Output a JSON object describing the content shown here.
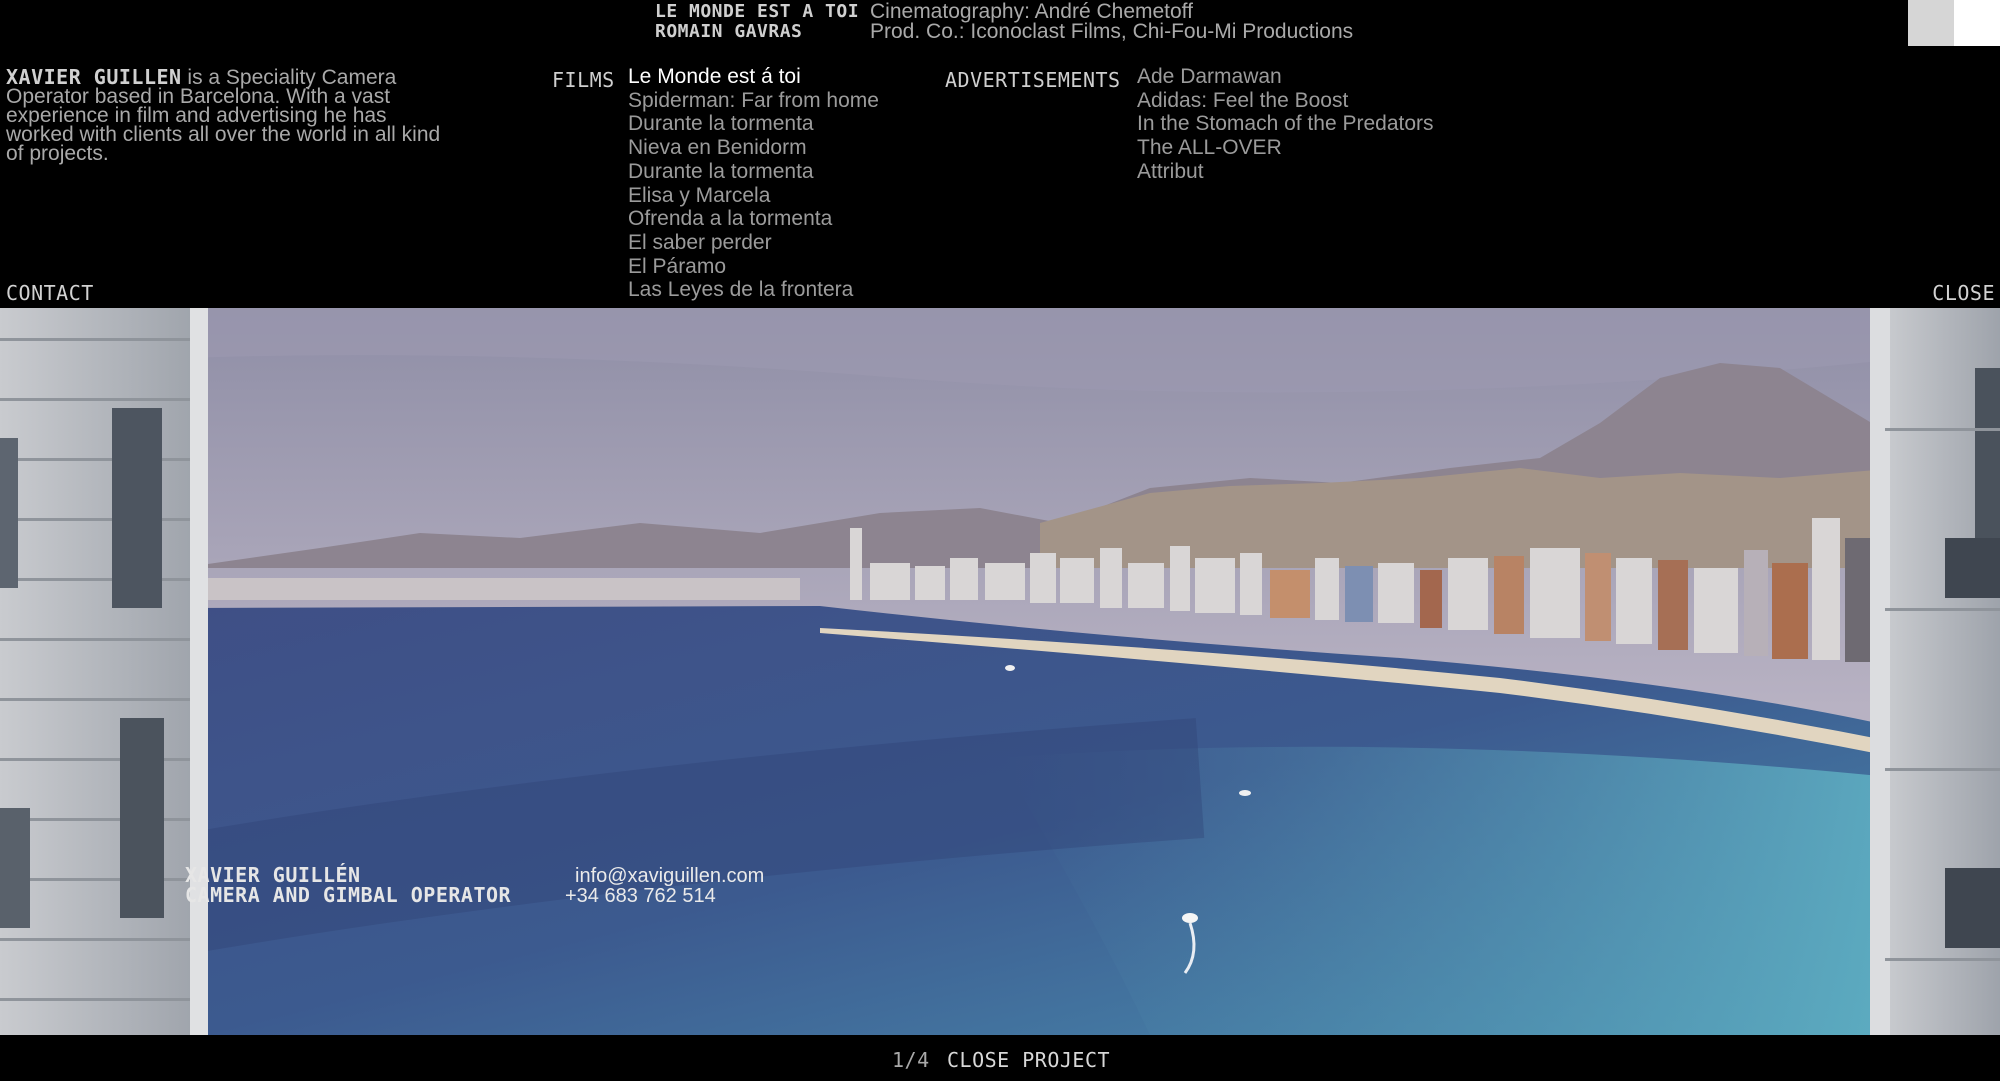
{
  "project": {
    "title": "LE MONDE EST A TOI",
    "director": "ROMAIN GAVRAS",
    "cinematography": "Cinematography: André Chemetoff",
    "production": "Prod. Co.: Iconoclast Films, Chi-Fou-Mi Productions"
  },
  "bio": {
    "name": "XAVIER GUILLEN",
    "text": " is a Speciality Camera Operator based in Barcelona. With a vast experience in film and advertising he has worked with clients all over the world in all kind of projects."
  },
  "films": {
    "label": "FILMS",
    "items": [
      "Le Monde est á toi",
      "Spiderman: Far from home",
      "Durante la tormenta",
      "Nieva en Benidorm",
      "Durante la tormenta",
      "Elisa y Marcela",
      "Ofrenda a la tormenta",
      "El saber perder",
      "El Páramo",
      "Las Leyes de la frontera"
    ]
  },
  "advertisements": {
    "label": "ADVERTISEMENTS",
    "items": [
      "Ade Darmawan",
      "Adidas: Feel the Boost",
      "In the Stomach of the Predators",
      "The ALL-OVER",
      "Attribut"
    ]
  },
  "nav": {
    "contact": "CONTACT",
    "close": "CLOSE"
  },
  "overlay": {
    "name": "XAVIER GUILLÉN",
    "role": "CAMERA AND GIMBAL OPERATOR",
    "email": "info@xaviguillen.com",
    "phone": "+34 683 762 514"
  },
  "footer": {
    "counter": "1/4",
    "close_project": "CLOSE PROJECT"
  }
}
